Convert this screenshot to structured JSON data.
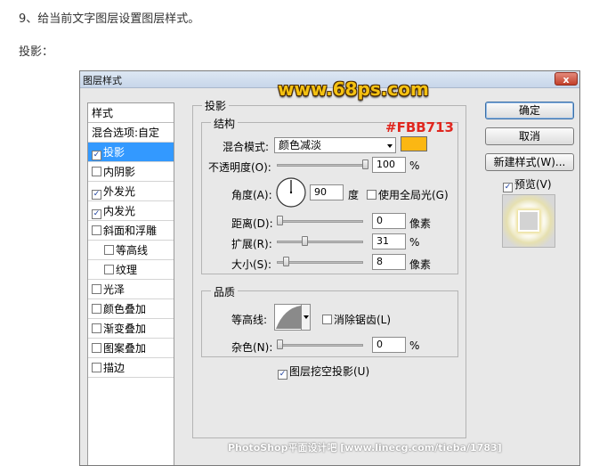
{
  "doc": {
    "step_text": "9、给当前文字图层设置图层样式。",
    "section_head": "投影："
  },
  "dialog": {
    "title": "图层样式",
    "close_symbol": "x",
    "watermark": "www.68ps.com",
    "hex_note": "#FBB713",
    "footer_watermark": "PhotoShop平面设计吧 [www.linecg.com/tieba/1783]"
  },
  "styles_panel": {
    "header": "样式",
    "items": [
      {
        "label": "混合选项:自定",
        "checkbox": false,
        "checked": false,
        "selected": false,
        "indent": false
      },
      {
        "label": "投影",
        "checkbox": true,
        "checked": true,
        "selected": true,
        "indent": false
      },
      {
        "label": "内阴影",
        "checkbox": true,
        "checked": false,
        "selected": false,
        "indent": false
      },
      {
        "label": "外发光",
        "checkbox": true,
        "checked": true,
        "selected": false,
        "indent": false
      },
      {
        "label": "内发光",
        "checkbox": true,
        "checked": true,
        "selected": false,
        "indent": false
      },
      {
        "label": "斜面和浮雕",
        "checkbox": true,
        "checked": false,
        "selected": false,
        "indent": false
      },
      {
        "label": "等高线",
        "checkbox": true,
        "checked": false,
        "selected": false,
        "indent": true
      },
      {
        "label": "纹理",
        "checkbox": true,
        "checked": false,
        "selected": false,
        "indent": true
      },
      {
        "label": "光泽",
        "checkbox": true,
        "checked": false,
        "selected": false,
        "indent": false
      },
      {
        "label": "颜色叠加",
        "checkbox": true,
        "checked": false,
        "selected": false,
        "indent": false
      },
      {
        "label": "渐变叠加",
        "checkbox": true,
        "checked": false,
        "selected": false,
        "indent": false
      },
      {
        "label": "图案叠加",
        "checkbox": true,
        "checked": false,
        "selected": false,
        "indent": false
      },
      {
        "label": "描边",
        "checkbox": true,
        "checked": false,
        "selected": false,
        "indent": false
      }
    ]
  },
  "drop_shadow": {
    "group_title": "投影",
    "structure": {
      "title": "结构",
      "blend_mode_label": "混合模式:",
      "blend_mode_value": "颜色减淡",
      "shadow_color": "#FBB713",
      "opacity_label": "不透明度(O):",
      "opacity_value": "100",
      "opacity_unit": "%",
      "opacity_level": 100,
      "angle_label": "角度(A):",
      "angle_value": "90",
      "angle_unit": "度",
      "global_light_label": "使用全局光(G)",
      "global_light_checked": false,
      "distance_label": "距离(D):",
      "distance_value": "0",
      "distance_unit": "像素",
      "distance_level": 0,
      "spread_label": "扩展(R):",
      "spread_value": "31",
      "spread_unit": "%",
      "spread_level": 31,
      "size_label": "大小(S):",
      "size_value": "8",
      "size_unit": "像素",
      "size_level": 8
    },
    "quality": {
      "title": "品质",
      "contour_label": "等高线:",
      "anti_alias_label": "消除锯齿(L)",
      "anti_alias_checked": false,
      "noise_label": "杂色(N):",
      "noise_value": "0",
      "noise_unit": "%",
      "noise_level": 0
    },
    "knockout_label": "图层挖空投影(U)",
    "knockout_checked": true
  },
  "buttons": {
    "ok": "确定",
    "cancel": "取消",
    "new_style": "新建样式(W)...",
    "preview_label": "预览(V)",
    "preview_checked": true
  },
  "icons": {
    "checkbox_checked": "✓",
    "dropdown": "chevron-down-icon"
  }
}
